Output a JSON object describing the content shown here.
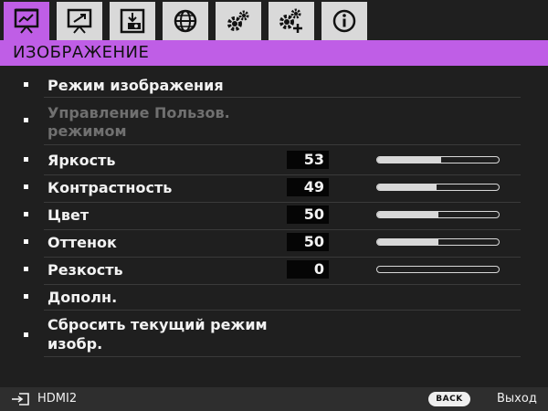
{
  "tabs": [
    {
      "icon": "picture-icon",
      "active": true
    },
    {
      "icon": "display-icon",
      "active": false
    },
    {
      "icon": "installation-icon",
      "active": false
    },
    {
      "icon": "globe-icon",
      "active": false
    },
    {
      "icon": "settings-gears-icon",
      "active": false
    },
    {
      "icon": "advanced-settings-icon",
      "active": false
    },
    {
      "icon": "info-icon",
      "active": false
    }
  ],
  "header": {
    "title": "ИЗОБРАЖЕНИЕ"
  },
  "menu": {
    "items": [
      {
        "label": "Режим изображения"
      },
      {
        "label_line1": "Управление Пользов.",
        "label_line2": "режимом",
        "disabled": true
      },
      {
        "label": "Яркость",
        "value": "53",
        "level": 0.53
      },
      {
        "label": "Контрастность",
        "value": "49",
        "level": 0.49
      },
      {
        "label": "Цвет",
        "value": "50",
        "level": 0.5
      },
      {
        "label": "Оттенок",
        "value": "50",
        "level": 0.5
      },
      {
        "label": "Резкость",
        "value": "0",
        "level": 0.0
      },
      {
        "label": "Дополн."
      },
      {
        "label_line1": "Сбросить текущий режим",
        "label_line2": "изобр."
      }
    ]
  },
  "footer": {
    "source": "HDMI2",
    "back_label": "BACK",
    "exit_label": "Выход"
  },
  "colors": {
    "accent": "#bf5ee6",
    "tab": "#d9d9d9",
    "background": "#1f1f1f"
  }
}
